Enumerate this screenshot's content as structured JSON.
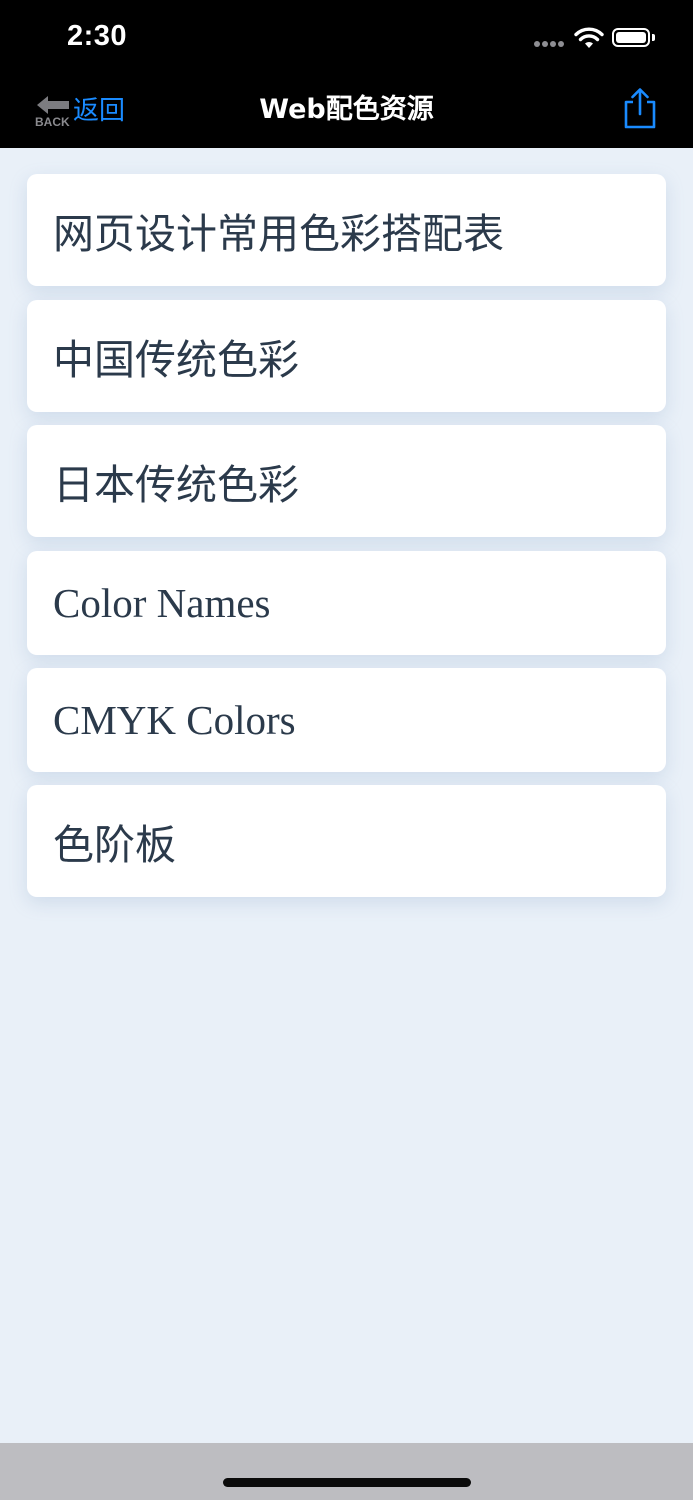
{
  "status_bar": {
    "time": "2:30"
  },
  "nav": {
    "back_icon_text": "BACK",
    "back_label": "返回",
    "title": "Web配色资源",
    "share_icon": "share-icon"
  },
  "list": {
    "items": [
      {
        "label": "网页设计常用色彩搭配表"
      },
      {
        "label": "中国传统色彩"
      },
      {
        "label": "日本传统色彩"
      },
      {
        "label": "Color Names"
      },
      {
        "label": "CMYK Colors"
      },
      {
        "label": "色阶板"
      }
    ]
  },
  "colors": {
    "accent": "#1a8bff",
    "background": "#e9f0f8",
    "bar": "#000000",
    "text": "#2b3a4b"
  }
}
